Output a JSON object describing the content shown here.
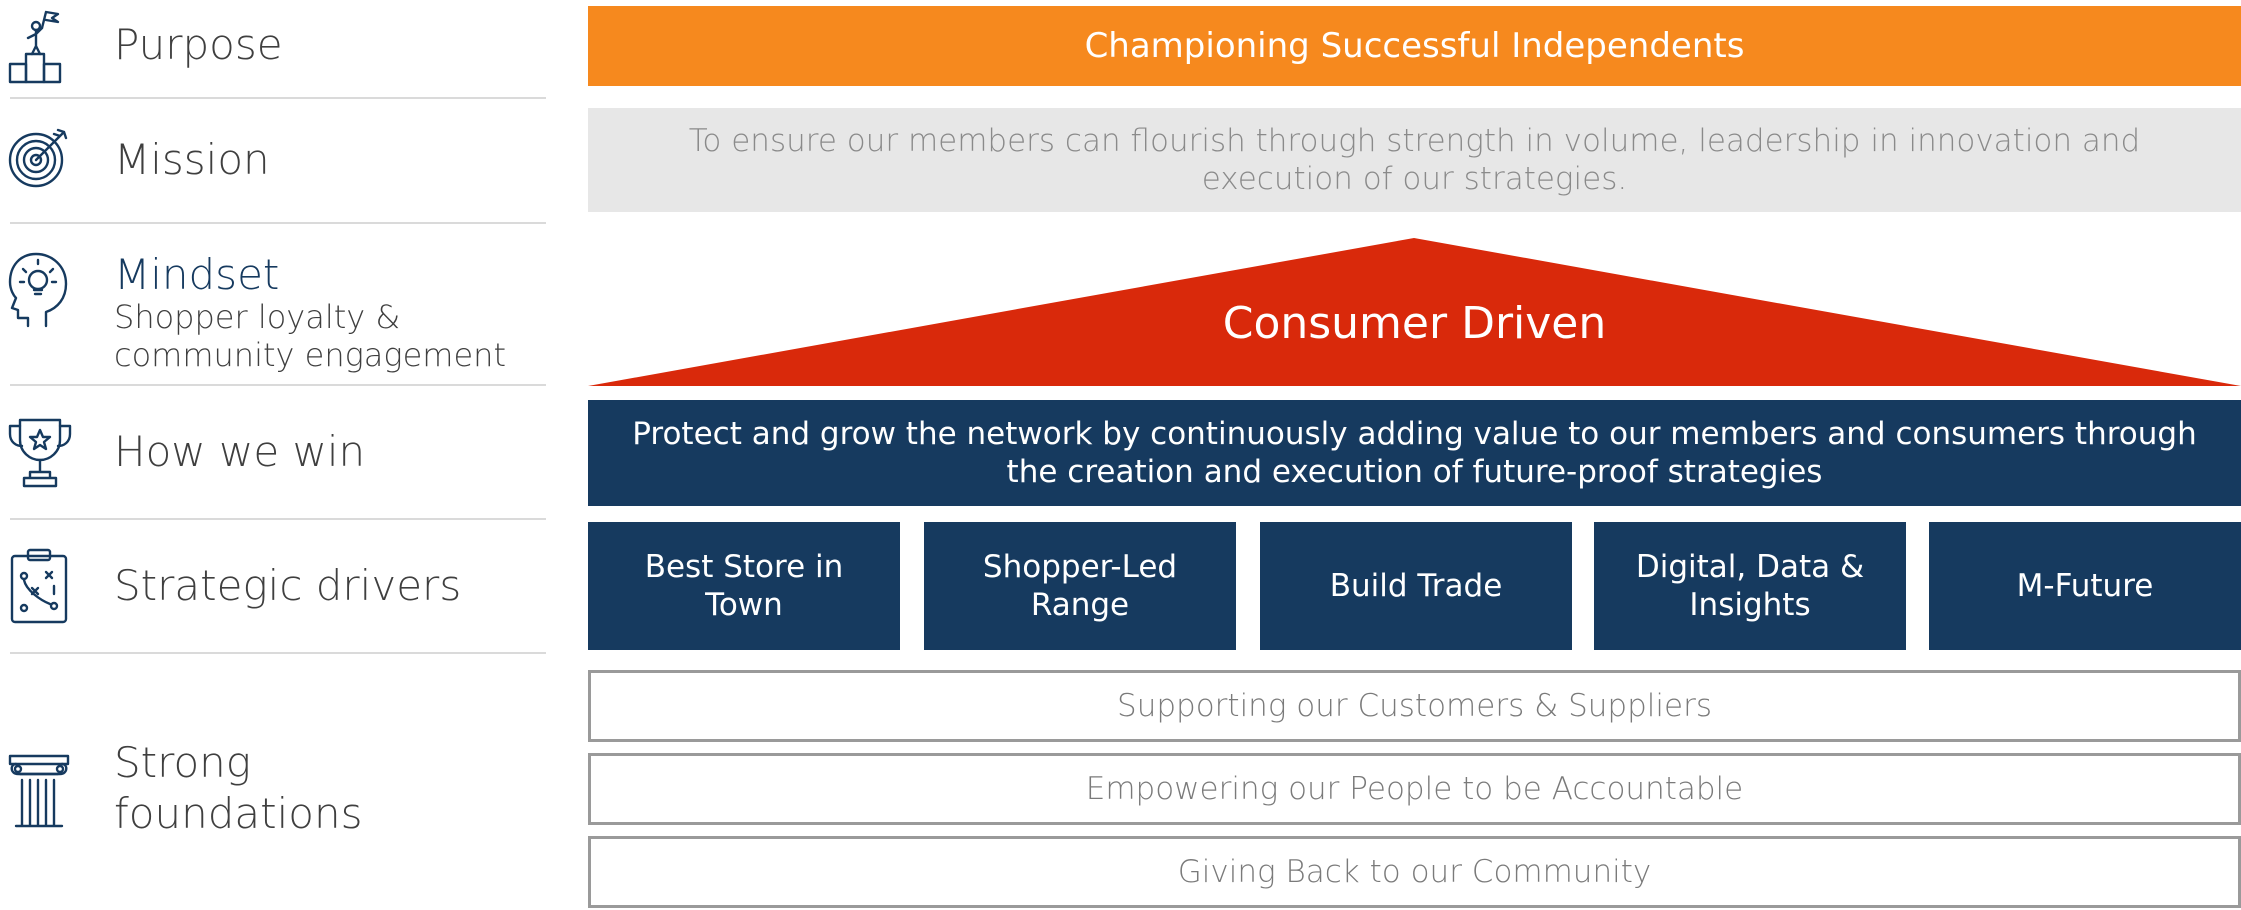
{
  "left_rows": [
    {
      "label": "Purpose",
      "icon": "podium-flag-icon"
    },
    {
      "label": "Mission",
      "icon": "target-icon"
    },
    {
      "label": "Mindset",
      "sub": "Shopper loyalty & community engagement",
      "sub_line1": "Shopper loyalty &",
      "sub_line2": "community engagement",
      "icon": "head-lightbulb-icon"
    },
    {
      "label": "How we win",
      "icon": "trophy-icon"
    },
    {
      "label": "Strategic drivers",
      "icon": "strategy-board-icon"
    },
    {
      "label": "Strong foundations",
      "label_line1": "Strong",
      "label_line2": "foundations",
      "icon": "pillar-icon"
    }
  ],
  "purpose": "Championing Successful Independents",
  "mission": "To ensure our members can flourish through strength in volume, leadership in innovation and execution of our strategies.",
  "mindset": "Consumer Driven",
  "how_we_win": "Protect and grow the network by continuously adding value to our members and consumers through the creation and execution of future-proof strategies",
  "strategic_drivers": [
    "Best Store in Town",
    "Shopper-Led Range",
    "Build Trade",
    "Digital, Data & Insights",
    "M-Future"
  ],
  "foundations": [
    "Supporting our Customers & Suppliers",
    "Empowering our People to be Accountable",
    "Giving Back to our Community"
  ],
  "colors": {
    "orange": "#f6891e",
    "red": "#d9290b",
    "navy": "#163a5f",
    "grey_band": "#e7e7e7",
    "mindset_label": "#163a5f"
  }
}
